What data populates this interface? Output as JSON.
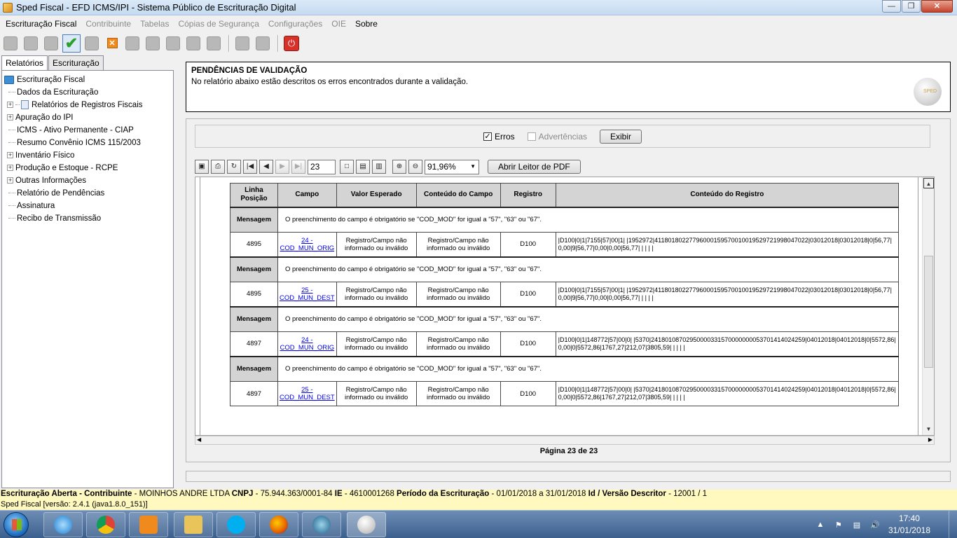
{
  "window": {
    "title": "Sped Fiscal - EFD ICMS/IPI - Sistema Público de Escrituração Digital"
  },
  "menu": [
    {
      "label": "Escrituração Fiscal",
      "enabled": true
    },
    {
      "label": "Contribuinte",
      "enabled": false
    },
    {
      "label": "Tabelas",
      "enabled": false
    },
    {
      "label": "Cópias de Segurança",
      "enabled": false
    },
    {
      "label": "Configurações",
      "enabled": false
    },
    {
      "label": "OIE",
      "enabled": false
    },
    {
      "label": "Sobre",
      "enabled": true
    }
  ],
  "left_tabs": [
    "Relatórios",
    "Escrituração"
  ],
  "tree": {
    "root": "Escrituração Fiscal",
    "items": [
      {
        "label": "Dados da Escrituração",
        "expandable": false
      },
      {
        "label": "Relatórios de Registros Fiscais",
        "expandable": true
      },
      {
        "label": "Apuração do IPI",
        "expandable": true
      },
      {
        "label": "ICMS - Ativo Permanente - CIAP",
        "expandable": false
      },
      {
        "label": "Resumo  Convênio ICMS 115/2003",
        "expandable": false
      },
      {
        "label": "Inventário Físico",
        "expandable": true
      },
      {
        "label": "Produção e Estoque - RCPE",
        "expandable": true
      },
      {
        "label": "Outras Informações",
        "expandable": true
      },
      {
        "label": "Relatório de Pendências",
        "expandable": false
      },
      {
        "label": "Assinatura",
        "expandable": false
      },
      {
        "label": "Recibo de Transmissão",
        "expandable": false
      }
    ]
  },
  "header": {
    "title": "PENDÊNCIAS DE VALIDAÇÃO",
    "subtitle": "No relatório abaixo estão descritos os erros encontrados durante a validação.",
    "logo_text": "SPED"
  },
  "filters": {
    "erros_label": "Erros",
    "erros_checked": true,
    "advertencias_label": "Advertências",
    "advertencias_checked": false,
    "exibir_label": "Exibir"
  },
  "viewer": {
    "page_value": "23",
    "zoom_value": "91,96%",
    "pdf_button": "Abrir Leitor de PDF",
    "page_label": "Página 23 de 23"
  },
  "table": {
    "headers": [
      "Linha Posição",
      "Campo",
      "Valor Esperado",
      "Conteúdo do Campo",
      "Registro",
      "Conteúdo do Registro"
    ],
    "message_label": "Mensagem",
    "entries": [
      {
        "message": "O preenchimento do campo é obrigatório se \"COD_MOD\" for igual a \"57\", \"63\" ou \"67\".",
        "line": "4895",
        "field": "24 - COD_MUN_ORIG",
        "expected": "Registro/Campo não informado ou inválido",
        "content": "Registro/Campo não informado ou inválido",
        "record": "D100",
        "record_content": "|D100|0|1|7155|57|00|1| |1952972|41180180227796000159570010019529721998047022|03012018|03012018|0|56,77|0,00|9|56,77|0,00|0,00|56,77| | | | |"
      },
      {
        "message": "O preenchimento do campo é obrigatório se \"COD_MOD\" for igual a \"57\", \"63\" ou \"67\".",
        "line": "4895",
        "field": "25 - COD_MUN_DEST",
        "expected": "Registro/Campo não informado ou inválido",
        "content": "Registro/Campo não informado ou inválido",
        "record": "D100",
        "record_content": "|D100|0|1|7155|57|00|1| |1952972|41180180227796000159570010019529721998047022|03012018|03012018|0|56,77|0,00|9|56,77|0,00|0,00|56,77| | | | |"
      },
      {
        "message": "O preenchimento do campo é obrigatório se \"COD_MOD\" for igual a \"57\", \"63\" ou \"67\".",
        "line": "4897",
        "field": "24 - COD_MUN_ORIG",
        "expected": "Registro/Campo não informado ou inválido",
        "content": "Registro/Campo não informado ou inválido",
        "record": "D100",
        "record_content": "|D100|0|1|148772|57|00|0| |5370|24180108702950000331570000000053701414024259|04012018|04012018|0|5572,86|0,00|0|5572,86|1767,27|212,07|3805,59| | | | |"
      },
      {
        "message": "O preenchimento do campo é obrigatório se \"COD_MOD\" for igual a \"57\", \"63\" ou \"67\".",
        "line": "4897",
        "field": "25 - COD_MUN_DEST",
        "expected": "Registro/Campo não informado ou inválido",
        "content": "Registro/Campo não informado ou inválido",
        "record": "D100",
        "record_content": "|D100|0|1|148772|57|00|0| |5370|24180108702950000331570000000053701414024259|04012018|04012018|0|5572,86|0,00|0|5572,86|1767,27|212,07|3805,59| | | | |"
      }
    ]
  },
  "status": {
    "l1_label": "Escrituração Aberta - Contribuinte",
    "l1_company": " - MOINHOS ANDRE LTDA ",
    "l1_cnpj_label": "CNPJ",
    "l1_cnpj": " - 75.944.363/0001-84 ",
    "l1_ie_label": "IE",
    "l1_ie": " - 4610001268 ",
    "l1_period_label": "Período da Escrituração",
    "l1_period": " - 01/01/2018 a 31/01/2018 ",
    "l1_id_label": "Id / Versão Descritor",
    "l1_id": " - 12001 / 1",
    "l2": "Sped Fiscal [versão: 2.4.1 (java1.8.0_151)]"
  },
  "taskbar": {
    "time": "17:40",
    "date": "31/01/2018",
    "icons": [
      "internet-explorer",
      "chrome",
      "media-player",
      "file-explorer",
      "skype",
      "firefox",
      "app-blue",
      "sped-fiscal"
    ]
  }
}
